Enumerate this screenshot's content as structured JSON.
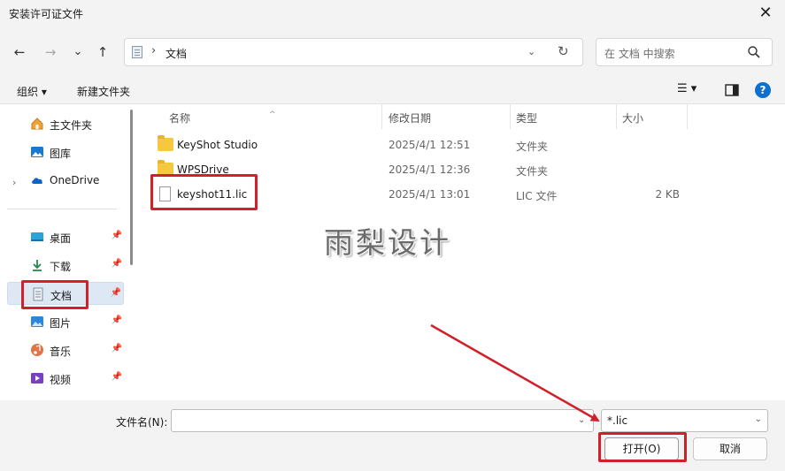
{
  "window": {
    "title": "安装许可证文件",
    "close": "✕"
  },
  "nav": {
    "back": "←",
    "forward": "→",
    "recent": "⌄",
    "up": "↑",
    "breadcrumb_sep": "›",
    "breadcrumb": "文档",
    "address_chevron": "⌄",
    "refresh": "↻"
  },
  "search": {
    "placeholder": "在 文档 中搜索"
  },
  "toolbar": {
    "organize": "组织 ▾",
    "new_folder": "新建文件夹",
    "view": "☰ ▾",
    "help": "?"
  },
  "sidebar": {
    "expander": "›",
    "items": [
      {
        "label": "主文件夹",
        "icon": "home-icon"
      },
      {
        "label": "图库",
        "icon": "gallery-icon"
      },
      {
        "label": "OneDrive",
        "icon": "cloud-icon"
      },
      {
        "label": "桌面",
        "icon": "desktop-icon",
        "pin": "📌"
      },
      {
        "label": "下载",
        "icon": "download-icon",
        "pin": "📌"
      },
      {
        "label": "文档",
        "icon": "documents-icon",
        "pin": "📌",
        "selected": true
      },
      {
        "label": "图片",
        "icon": "pictures-icon",
        "pin": "📌"
      },
      {
        "label": "音乐",
        "icon": "music-icon",
        "pin": "📌"
      },
      {
        "label": "视频",
        "icon": "video-icon",
        "pin": "📌"
      }
    ]
  },
  "columns": {
    "name": "名称",
    "modified": "修改日期",
    "type": "类型",
    "size": "大小",
    "sort_caret": "^"
  },
  "files": [
    {
      "name": "KeyShot Studio",
      "modified": "2025/4/1 12:51",
      "type": "文件夹",
      "size": "",
      "kind": "folder"
    },
    {
      "name": "WPSDrive",
      "modified": "2025/4/1 12:36",
      "type": "文件夹",
      "size": "",
      "kind": "folder"
    },
    {
      "name": "keyshot11.lic",
      "modified": "2025/4/1 13:01",
      "type": "LIC 文件",
      "size": "2 KB",
      "kind": "file"
    }
  ],
  "watermark": "雨梨设计",
  "footer": {
    "filename_label": "文件名(N):",
    "filename_value": "",
    "filename_chevron": "⌄",
    "filter": "*.lic",
    "filter_chevron": "⌄",
    "open": "打开(O)",
    "cancel": "取消"
  },
  "colors": {
    "accent": "#0d6fd0",
    "highlight": "#d0202a",
    "folder": "#f6c842",
    "selection": "#dde8f4"
  }
}
